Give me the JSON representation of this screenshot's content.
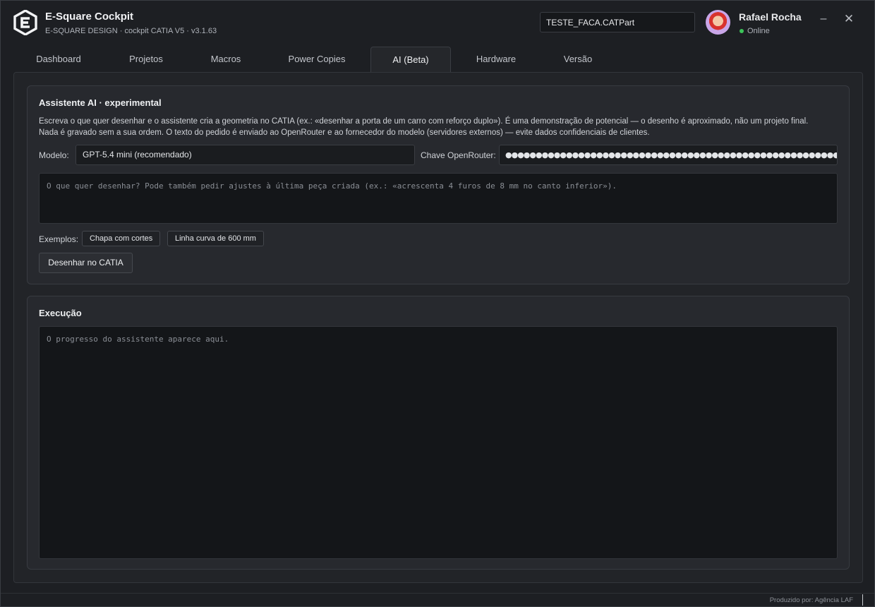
{
  "app": {
    "title": "E-Square Cockpit",
    "subtitle": "E-SQUARE DESIGN · cockpit CATIA V5 · v3.1.63"
  },
  "header": {
    "file_value": "TESTE_FACA.CATPart",
    "user_name": "Rafael Rocha",
    "user_status": "Online",
    "status_color": "#3cc45a",
    "minimize_glyph": "–",
    "close_glyph": "✕"
  },
  "tabs": [
    {
      "label": "Dashboard",
      "active": false
    },
    {
      "label": "Projetos",
      "active": false
    },
    {
      "label": "Macros",
      "active": false
    },
    {
      "label": "Power Copies",
      "active": false
    },
    {
      "label": "AI (Beta)",
      "active": true
    },
    {
      "label": "Hardware",
      "active": false
    },
    {
      "label": "Versão",
      "active": false
    }
  ],
  "assistant": {
    "title": "Assistente AI · experimental",
    "description_line1": "Escreva o que quer desenhar e o assistente cria a geometria no CATIA (ex.: «desenhar a porta de um carro com reforço duplo»). É uma demonstração de potencial — o desenho é aproximado, não um projeto final.",
    "description_line2": "Nada é gravado sem a sua ordem. O texto do pedido é enviado ao OpenRouter e ao fornecedor do modelo (servidores externos) — evite dados confidenciais de clientes.",
    "model_label": "Modelo:",
    "model_value": "GPT-5.4 mini (recomendado)",
    "key_label": "Chave OpenRouter:",
    "key_value": "●●●●●●●●●●●●●●●●●●●●●●●●●●●●●●●●●●●●●●●●●●●●●●●●●●●●●●●●●●●●●●●●●●●●●●●●●●●",
    "prompt_placeholder": "O que quer desenhar? Pode também pedir ajustes à última peça criada (ex.: «acrescenta 4 furos de 8 mm no canto inferior»).",
    "examples_label": "Exemplos:",
    "examples": [
      "Chapa com cortes",
      "Linha curva de 600 mm"
    ],
    "draw_button": "Desenhar no CATIA"
  },
  "execution": {
    "title": "Execução",
    "log_placeholder": "O progresso do assistente aparece aqui."
  },
  "footer": {
    "credit": "Produzido por: Agência LAF"
  }
}
